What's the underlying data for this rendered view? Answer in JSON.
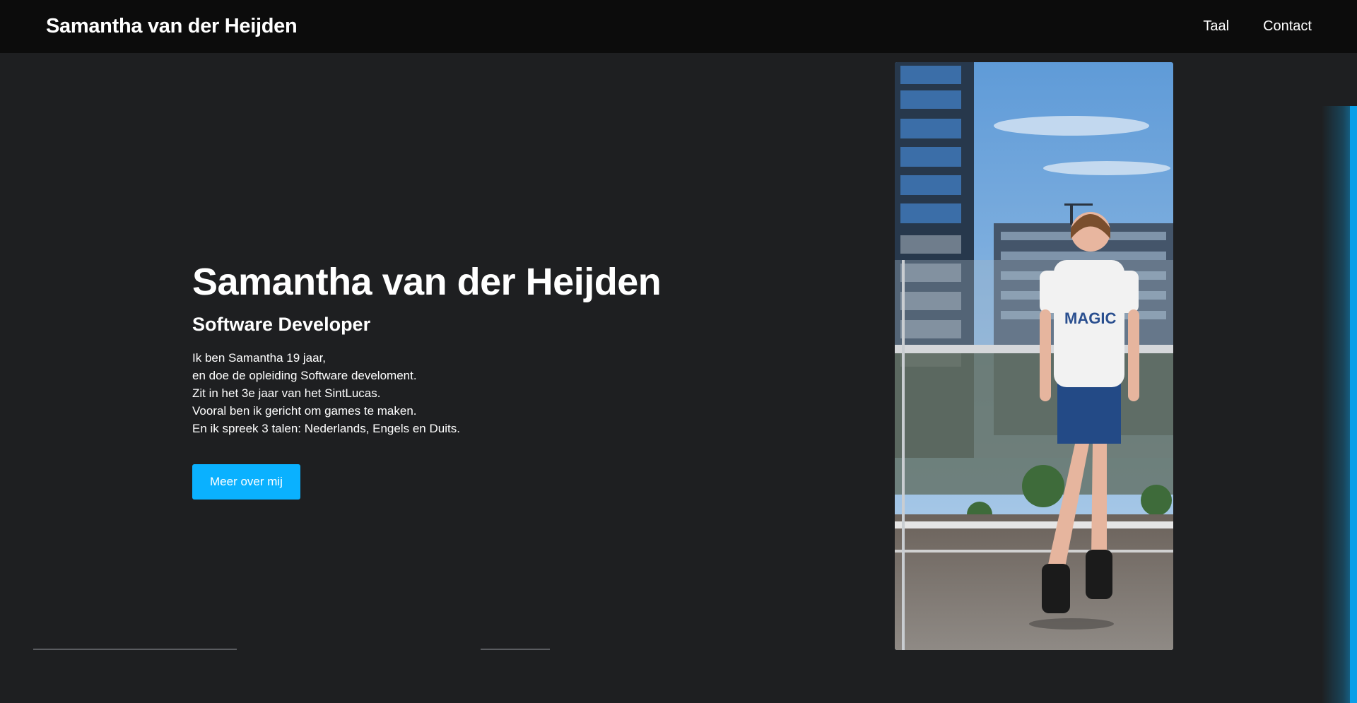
{
  "navbar": {
    "brand": "Samantha van der Heijden",
    "links": [
      {
        "label": "Taal"
      },
      {
        "label": "Contact"
      }
    ]
  },
  "hero": {
    "title": "Samantha van der Heijden",
    "subtitle": "Software Developer",
    "bio": [
      "Ik ben Samantha 19 jaar,",
      "en doe de opleiding Software develoment.",
      "Zit in het 3e jaar van het SintLucas.",
      "Vooral ben ik gericht om games te maken.",
      "En ik spreek 3 talen: Nederlands, Engels en Duits."
    ],
    "cta_label": "Meer over mij",
    "photo_shirt_text": "MAGIC"
  },
  "colors": {
    "background": "#1e1f21",
    "navbar": "#0c0c0c",
    "accent": "#0ab1ff"
  }
}
